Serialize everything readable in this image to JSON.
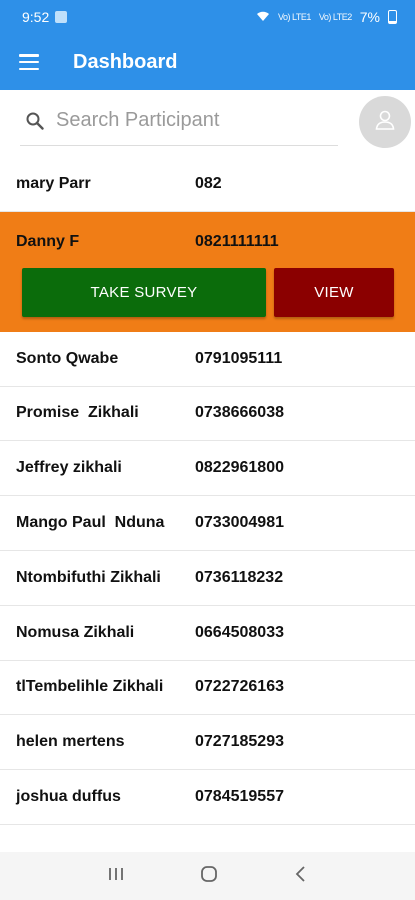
{
  "status_bar": {
    "time": "9:52",
    "battery": "7%",
    "signal_1": "Vo) LTE1",
    "signal_2": "Vo) LTE2"
  },
  "app_bar": {
    "title": "Dashboard"
  },
  "search": {
    "placeholder": "Search Participant",
    "value": ""
  },
  "participants": [
    {
      "name": "mary Parr",
      "phone": "082"
    },
    {
      "name": "Danny F",
      "phone": "0821111111"
    },
    {
      "name": "Sonto Qwabe",
      "phone": "0791095111"
    },
    {
      "name": "Promise  Zikhali",
      "phone": "0738666038"
    },
    {
      "name": "Jeffrey zikhali",
      "phone": "0822961800"
    },
    {
      "name": "Mango Paul  Nduna",
      "phone": "0733004981"
    },
    {
      "name": "Ntombifuthi Zikhali",
      "phone": "0736118232"
    },
    {
      "name": "Nomusa Zikhali",
      "phone": "0664508033"
    },
    {
      "name": "tlTembelihle Zikhali",
      "phone": "0722726163"
    },
    {
      "name": "helen mertens",
      "phone": "0727185293"
    },
    {
      "name": "joshua duffus",
      "phone": "0784519557"
    }
  ],
  "selected_actions": {
    "take_survey": "TAKE SURVEY",
    "view": "VIEW"
  },
  "colors": {
    "primary": "#2e90e8",
    "selected_row": "#f07d16",
    "survey_button": "#0b6c0b",
    "view_button": "#8b0000"
  },
  "icons": {
    "menu": "menu-icon",
    "search": "search-icon",
    "avatar": "person-icon",
    "nav_recents": "recents-icon",
    "nav_home": "home-icon",
    "nav_back": "back-icon"
  }
}
